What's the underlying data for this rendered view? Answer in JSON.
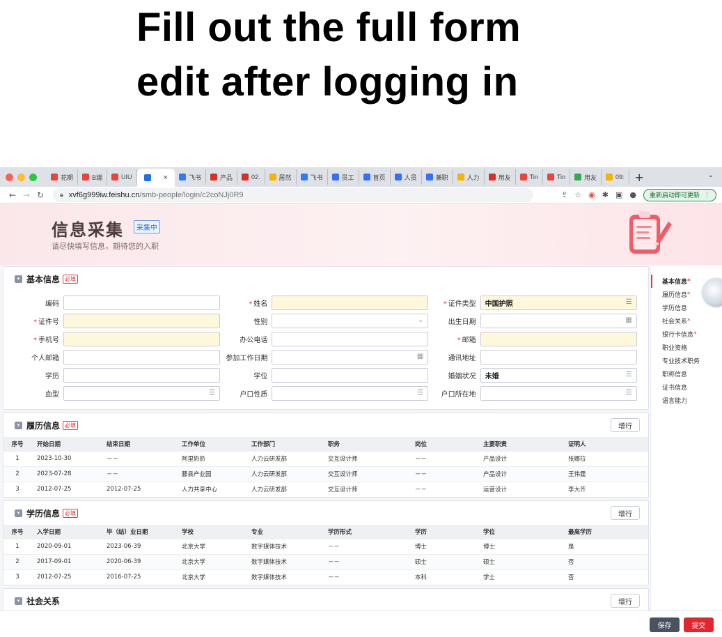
{
  "caption": {
    "line1": "Fill out the full form",
    "line2": "edit after logging in"
  },
  "browser": {
    "tabs": [
      {
        "label": "花期",
        "color": "#e8453c"
      },
      {
        "label": "B端",
        "color": "#e8453c"
      },
      {
        "label": "UIU",
        "color": "#e8453c"
      },
      {
        "label": "",
        "color": "#1a73e8",
        "active": true
      },
      {
        "label": "飞书",
        "color": "#2f7df6"
      },
      {
        "label": "产品",
        "color": "#d93025"
      },
      {
        "label": "02.",
        "color": "#d93025"
      },
      {
        "label": "居然",
        "color": "#f4b400"
      },
      {
        "label": "飞书",
        "color": "#2f7df6"
      },
      {
        "label": "员工",
        "color": "#3370ff"
      },
      {
        "label": "首页",
        "color": "#3370ff"
      },
      {
        "label": "人员",
        "color": "#3370ff"
      },
      {
        "label": "兼职",
        "color": "#3370ff"
      },
      {
        "label": "人力",
        "color": "#f4b400"
      },
      {
        "label": "用友",
        "color": "#d93025"
      },
      {
        "label": "Tin",
        "color": "#e8453c"
      },
      {
        "label": "Tin",
        "color": "#e8453c"
      },
      {
        "label": "用友",
        "color": "#34a853"
      },
      {
        "label": "09:",
        "color": "#f4b400"
      }
    ],
    "url_host": "xvf6g999iw.feishu.cn",
    "url_path": "/smb-people/login/c2coNJj0R9",
    "update_label": "重新启动即可更新"
  },
  "hero": {
    "title": "信息采集",
    "badge": "采集中",
    "subtitle": "请尽快填写信息，期待您的入职"
  },
  "basic": {
    "title": "基本信息",
    "required": "必填",
    "rows": [
      [
        {
          "label": "编码",
          "required": false,
          "value": "",
          "icon": ""
        },
        {
          "label": "姓名",
          "required": true,
          "value": "",
          "icon": ""
        },
        {
          "label": "证件类型",
          "required": true,
          "value": "中国护照",
          "icon": "list"
        }
      ],
      [
        {
          "label": "证件号",
          "required": true,
          "value": "",
          "icon": ""
        },
        {
          "label": "性别",
          "required": false,
          "value": "",
          "icon": "chevron"
        },
        {
          "label": "出生日期",
          "required": false,
          "value": "",
          "icon": "calendar"
        }
      ],
      [
        {
          "label": "手机号",
          "required": true,
          "value": "",
          "icon": ""
        },
        {
          "label": "办公电话",
          "required": false,
          "value": "",
          "icon": ""
        },
        {
          "label": "邮箱",
          "required": true,
          "value": "",
          "icon": ""
        }
      ],
      [
        {
          "label": "个人邮箱",
          "required": false,
          "value": "",
          "icon": ""
        },
        {
          "label": "参加工作日期",
          "required": false,
          "value": "",
          "icon": "calendar"
        },
        {
          "label": "通讯地址",
          "required": false,
          "value": "",
          "icon": ""
        }
      ],
      [
        {
          "label": "学历",
          "required": false,
          "value": "",
          "icon": ""
        },
        {
          "label": "学位",
          "required": false,
          "value": "",
          "icon": ""
        },
        {
          "label": "婚姻状况",
          "required": false,
          "value": "未婚",
          "icon": "list"
        }
      ],
      [
        {
          "label": "血型",
          "required": false,
          "value": "",
          "icon": "list"
        },
        {
          "label": "户口性质",
          "required": false,
          "value": "",
          "icon": "list"
        },
        {
          "label": "户口所在地",
          "required": false,
          "value": "",
          "icon": "list"
        }
      ]
    ]
  },
  "resume": {
    "title": "履历信息",
    "required": "必填",
    "add_label": "增行",
    "columns": [
      "序号",
      "开始日期",
      "结束日期",
      "工作单位",
      "工作部门",
      "职务",
      "岗位",
      "主要职责",
      "证明人"
    ],
    "rows": [
      [
        "1",
        "2023-10-30",
        "－－",
        "阿里奶奶",
        "人力云研发部",
        "交互设计师",
        "－－",
        "产品设计",
        "张娜拉"
      ],
      [
        "2",
        "2023-07-28",
        "－－",
        "藤县产业园",
        "人力云研发部",
        "交互设计师",
        "－－",
        "产品设计",
        "王伟霆"
      ],
      [
        "3",
        "2012-07-25",
        "2012-07-25",
        "人力共享中心",
        "人力云研发部",
        "交互设计师",
        "－－",
        "运营设计",
        "李大齐"
      ]
    ]
  },
  "education": {
    "title": "学历信息",
    "required": "必填",
    "add_label": "增行",
    "columns": [
      "序号",
      "入学日期",
      "毕（结）业日期",
      "学校",
      "专业",
      "学历形式",
      "学历",
      "学位",
      "最高学历"
    ],
    "rows": [
      [
        "1",
        "2020-09-01",
        "2023-06-39",
        "北京大学",
        "数字媒体技术",
        "－－",
        "博士",
        "博士",
        "是"
      ],
      [
        "2",
        "2017-09-01",
        "2020-06-39",
        "北京大学",
        "数字媒体技术",
        "－－",
        "硕士",
        "硕士",
        "否"
      ],
      [
        "3",
        "2012-07-25",
        "2016-07-25",
        "北京大学",
        "数字媒体技术",
        "－－",
        "本科",
        "学士",
        "否"
      ]
    ]
  },
  "social": {
    "title": "社会关系",
    "add_label": "增行"
  },
  "sidenav": [
    {
      "label": "基本信息",
      "required": true,
      "active": true
    },
    {
      "label": "履历信息",
      "required": true,
      "active": false
    },
    {
      "label": "学历信息",
      "required": false,
      "active": false
    },
    {
      "label": "社会关系",
      "required": true,
      "active": false
    },
    {
      "label": "银行卡信息",
      "required": true,
      "active": false
    },
    {
      "label": "职业资格",
      "required": false,
      "active": false
    },
    {
      "label": "专业技术职务",
      "required": false,
      "active": false
    },
    {
      "label": "职称信息",
      "required": false,
      "active": false
    },
    {
      "label": "证书信息",
      "required": false,
      "active": false
    },
    {
      "label": "语言能力",
      "required": false,
      "active": false
    }
  ],
  "footer": {
    "save_label": "保存",
    "submit_label": "提交"
  },
  "colors": {
    "accent_red": "#e5252e",
    "required_fill": "#fdf7dc",
    "save_dark": "#4a5262"
  }
}
